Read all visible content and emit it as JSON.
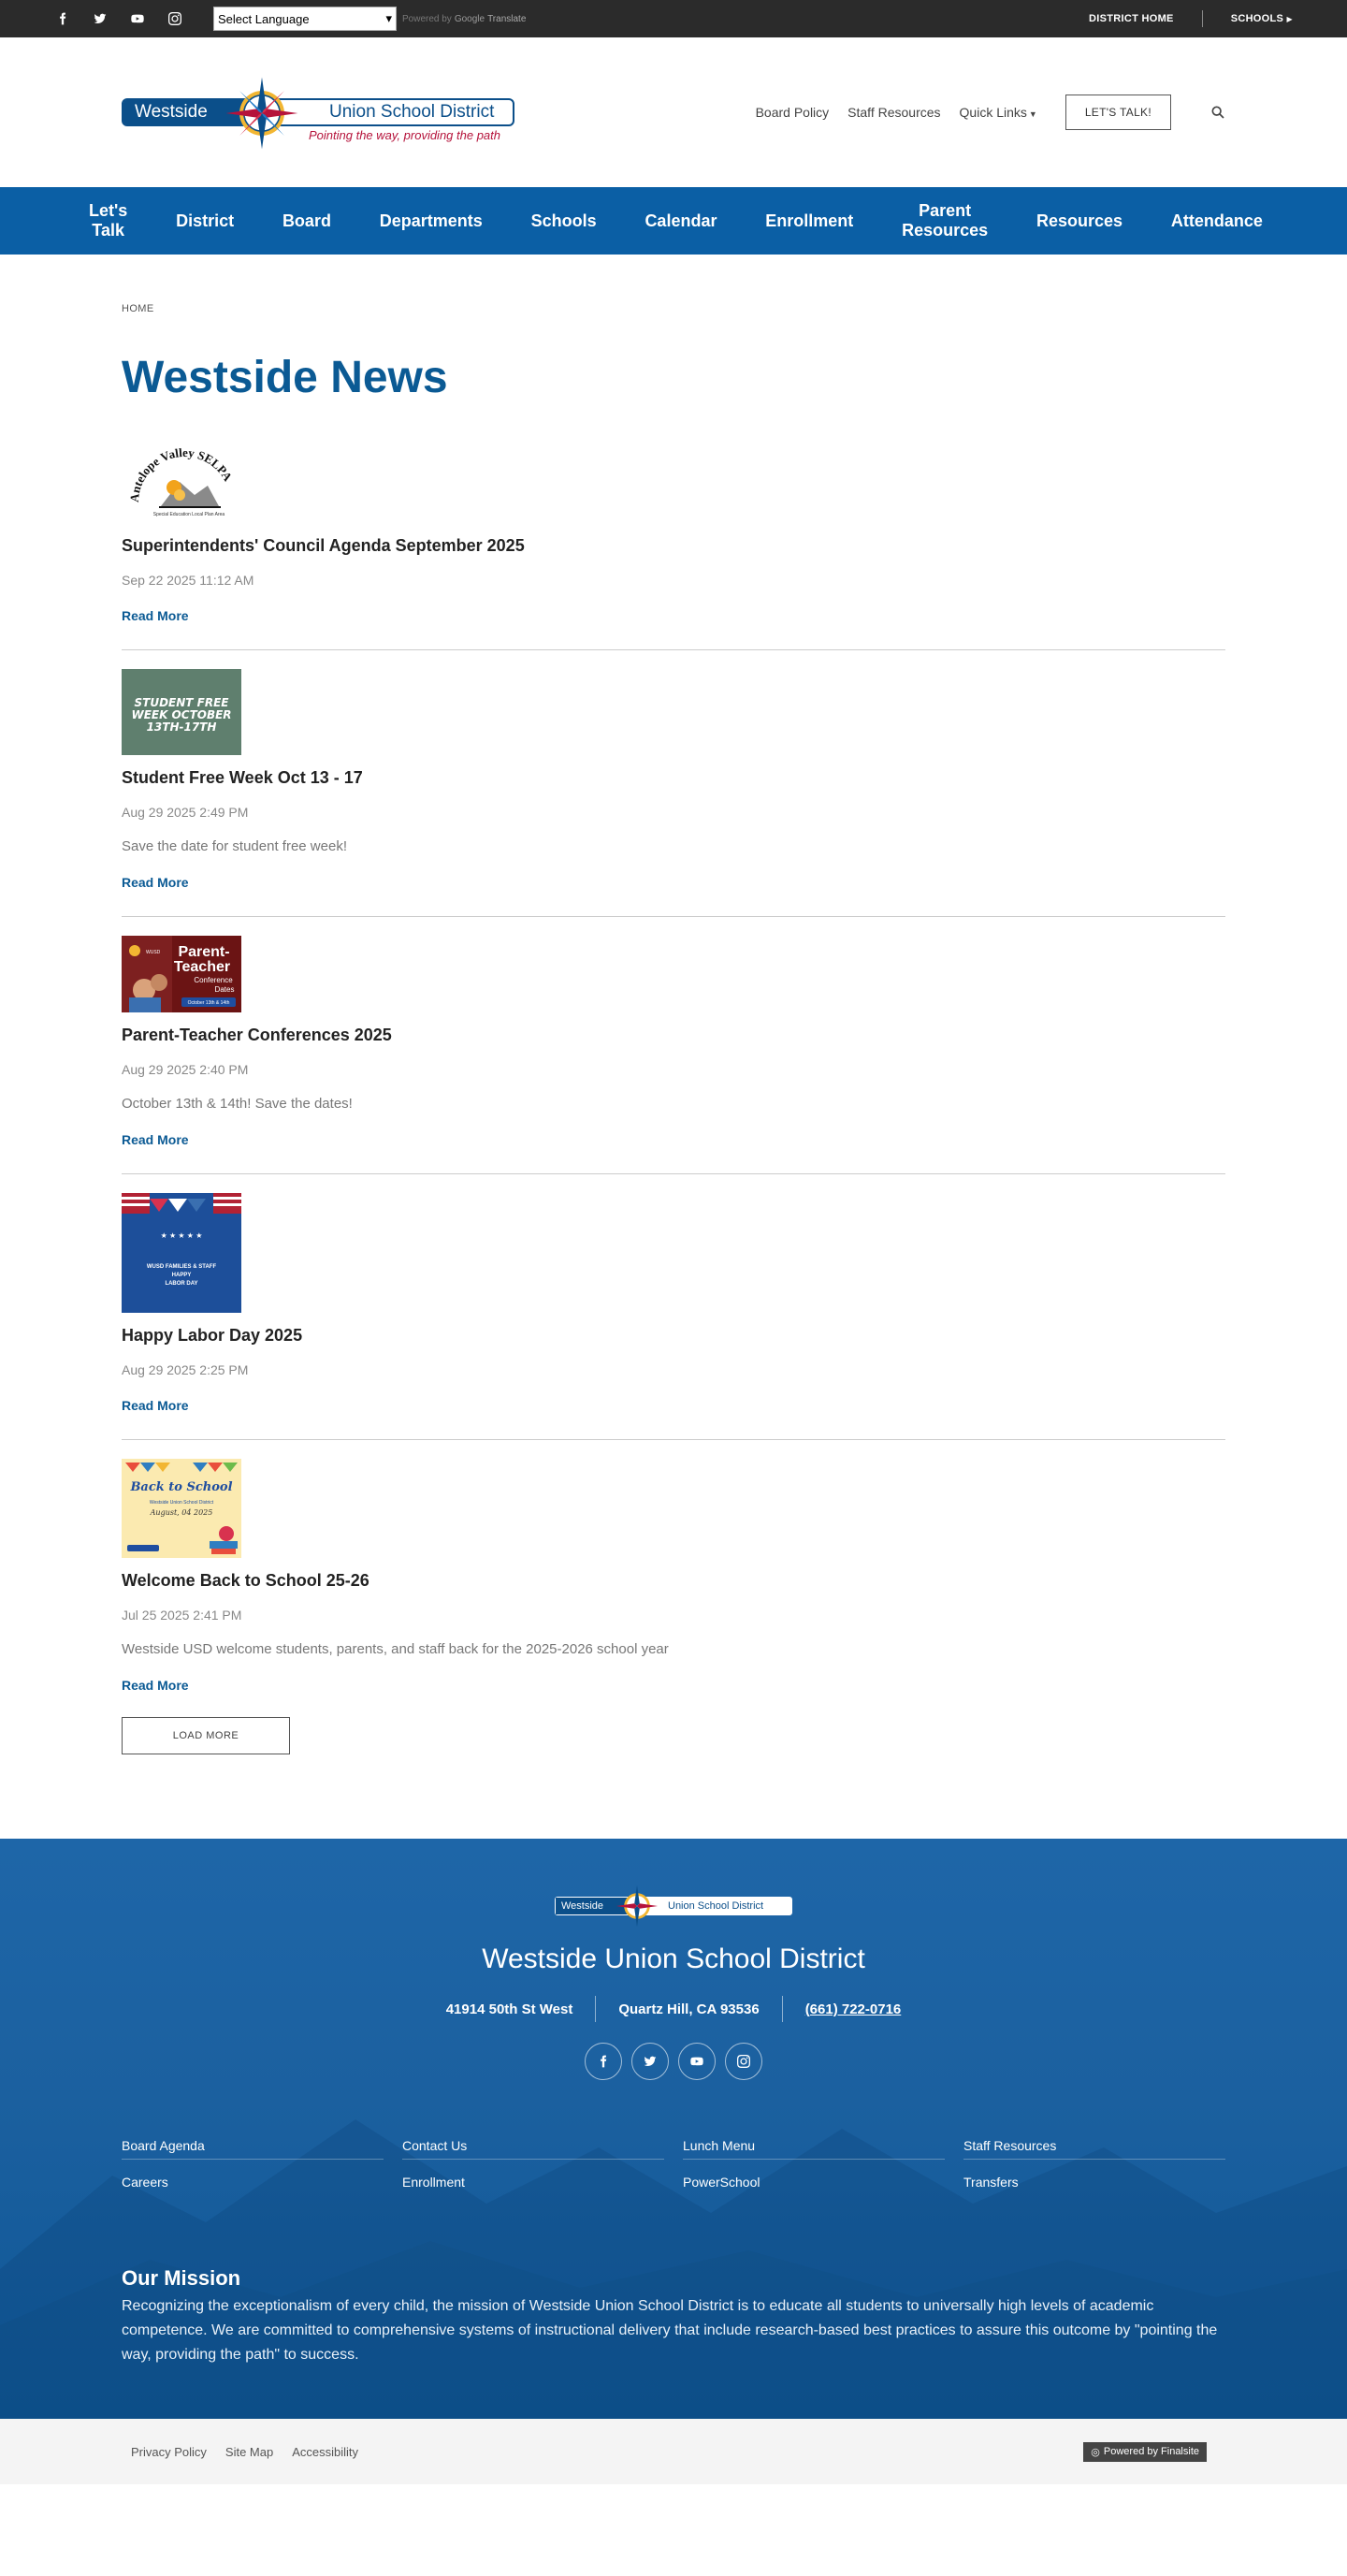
{
  "topbar": {
    "social": [
      "facebook-icon",
      "twitter-icon",
      "youtube-icon",
      "instagram-icon"
    ],
    "language_select": "Select Language",
    "powered_by": "Powered by",
    "google": "Google",
    "translate": "Translate",
    "district_home": "DISTRICT HOME",
    "schools": "SCHOOLS"
  },
  "header": {
    "logo_left": "Westside",
    "logo_right": "Union School District",
    "tagline": "Pointing the way, providing the path",
    "links": [
      "Board Policy",
      "Staff Resources",
      "Quick Links"
    ],
    "cta": "LET'S TALK!"
  },
  "mainnav": [
    "Let's Talk",
    "District",
    "Board",
    "Departments",
    "Schools",
    "Calendar",
    "Enrollment",
    "Parent Resources",
    "Resources",
    "Attendance"
  ],
  "breadcrumb": "HOME",
  "page_title": "Westside News",
  "thumbs": {
    "selpa_line1": "Antelope Valley SELPA",
    "selpa_line2": "Special Education Local Plan Area",
    "free_week": [
      "STUDENT FREE",
      "WEEK OCTOBER",
      "13TH-17TH"
    ],
    "ptc_brand": "WUSD",
    "ptc_title": [
      "Parent-",
      "Teacher"
    ],
    "ptc_sub": [
      "Conference",
      "Dates"
    ],
    "ptc_badge": "October 13th & 14th",
    "labor": [
      "WUSD FAMILIES & STAFF",
      "HAPPY",
      "LABOR DAY"
    ],
    "bts_title": "Back to School",
    "bts_sub": "Westside Union School District",
    "bts_date": "August, 04 2025"
  },
  "news": [
    {
      "title": "Superintendents' Council Agenda September 2025",
      "date": "Sep 22 2025 11:12 AM",
      "desc": "",
      "read_more": "Read More"
    },
    {
      "title": "Student Free Week Oct 13 - 17",
      "date": "Aug 29 2025 2:49 PM",
      "desc": "Save the date for student free week!",
      "read_more": "Read More"
    },
    {
      "title": "Parent-Teacher Conferences 2025",
      "date": "Aug 29 2025 2:40 PM",
      "desc": "October 13th & 14th! Save the dates!",
      "read_more": "Read More"
    },
    {
      "title": "Happy Labor Day 2025",
      "date": "Aug 29 2025 2:25 PM",
      "desc": "",
      "read_more": "Read More"
    },
    {
      "title": "Welcome Back to School 25-26",
      "date": "Jul 25 2025 2:41 PM",
      "desc": "Westside USD welcome students, parents, and staff back for the 2025-2026 school year",
      "read_more": "Read More"
    }
  ],
  "load_more": "LOAD MORE",
  "footer": {
    "logo_left": "Westside",
    "logo_right": "Union School District",
    "name": "Westside Union School District",
    "address": "41914 50th St West",
    "city": "Quartz Hill, CA  93536",
    "phone": "(661) 722-0716",
    "social": [
      "facebook-icon",
      "twitter-icon",
      "youtube-icon",
      "instagram-icon"
    ],
    "links": [
      "Board Agenda",
      "Contact Us",
      "Lunch Menu",
      "Staff Resources",
      "Careers",
      "Enrollment",
      "PowerSchool",
      "Transfers"
    ],
    "mission_title": "Our Mission",
    "mission_text": "Recognizing the exceptionalism of every child, the mission of Westside Union School District is to educate all students to universally high levels of academic competence. We are committed to comprehensive systems of instructional delivery that include research-based best practices to assure this outcome by \"pointing the way, providing the path\" to success."
  },
  "bottom": {
    "links": [
      "Privacy Policy",
      "Site Map",
      "Accessibility"
    ],
    "powered": "Powered by Finalsite"
  },
  "colors": {
    "brand_blue": "#0b5fa5",
    "title_blue": "#0b5a94",
    "topbar": "#2b2b2b",
    "tagline_red": "#b5133b"
  }
}
